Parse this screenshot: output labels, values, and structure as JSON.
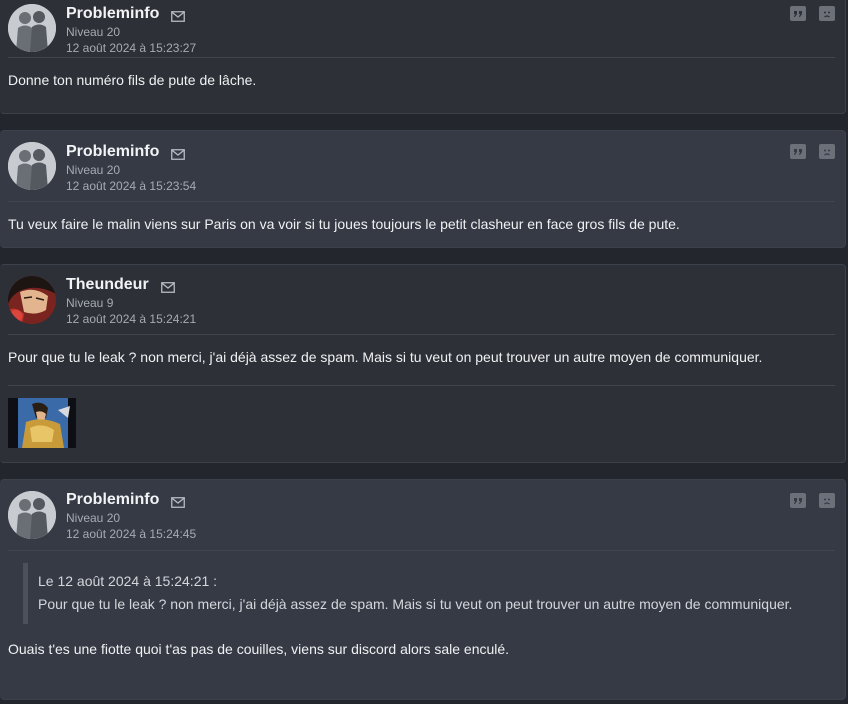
{
  "posts": [
    {
      "author": "Probleminfo",
      "level": "Niveau 20",
      "date": "12 août 2024 à 15:23:27",
      "message": "Donne ton numéro fils de pute de lâche.",
      "avatar": "silhouette-avatar"
    },
    {
      "author": "Probleminfo",
      "level": "Niveau 20",
      "date": "12 août 2024 à 15:23:54",
      "message": "Tu veux faire le malin viens sur Paris on va voir si tu joues toujours le petit clasheur en face gros fils de pute.",
      "avatar": "silhouette-avatar"
    },
    {
      "author": "Theundeur",
      "level": "Niveau 9",
      "date": "12 août 2024 à 15:24:21",
      "message": "Pour que tu le leak ? non merci, j'ai déjà assez de spam. Mais si tu veut on peut trouver un autre moyen de communiquer.",
      "avatar": "anime-character-avatar",
      "signature": "anime-warrior-signature-image"
    },
    {
      "author": "Probleminfo",
      "level": "Niveau 20",
      "date": "12 août 2024 à 15:24:45",
      "quote_header": "Le 12 août 2024 à 15:24:21 :",
      "quote_text": "Pour que tu le leak ? non merci, j'ai déjà assez de spam. Mais si tu veut on peut trouver un autre moyen de communiquer.",
      "message": "Ouais t'es une fiotte quoi t'as pas de couilles, viens sur discord alors sale enculé.",
      "avatar": "silhouette-avatar"
    }
  ],
  "icons": {
    "message": "mail-icon",
    "quote": "quote-icon",
    "report": "sad-face-icon"
  },
  "colors": {
    "background": "#23262c",
    "post_dark": "#2d3037",
    "post_light": "#353a44",
    "muted_text": "#a6abb3"
  }
}
